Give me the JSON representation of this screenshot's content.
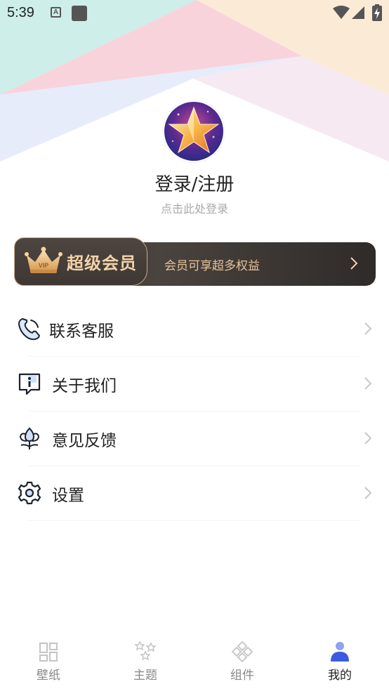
{
  "status_bar": {
    "time": "5:39",
    "a_label": "A"
  },
  "profile": {
    "title": "登录/注册",
    "subtitle": "点击此处登录"
  },
  "vip": {
    "badge": "VIP",
    "title": "超级会员",
    "description": "会员可享超多权益"
  },
  "menu": {
    "items": [
      {
        "label": "联系客服",
        "icon": "phone-icon"
      },
      {
        "label": "关于我们",
        "icon": "info-chat-icon"
      },
      {
        "label": "意见反馈",
        "icon": "flower-icon"
      },
      {
        "label": "设置",
        "icon": "gear-icon"
      }
    ]
  },
  "bottom_nav": {
    "items": [
      {
        "label": "壁纸",
        "icon": "grid-icon",
        "active": false
      },
      {
        "label": "主题",
        "icon": "stars-icon",
        "active": false
      },
      {
        "label": "组件",
        "icon": "components-icon",
        "active": false
      },
      {
        "label": "我的",
        "icon": "person-icon",
        "active": true
      }
    ]
  },
  "colors": {
    "accent": "#3d5be0",
    "vip_gold": "#f3d3aa",
    "vip_dark": "#3a3532"
  }
}
